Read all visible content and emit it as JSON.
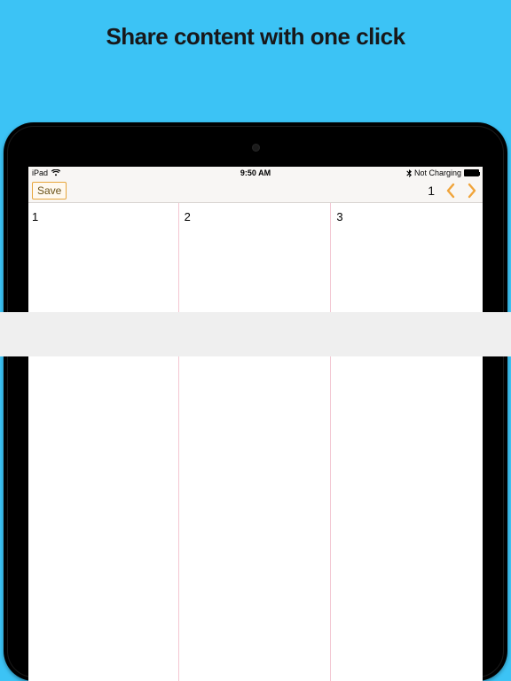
{
  "headline": "Share content with one click",
  "statusbar": {
    "carrier": "iPad",
    "wifi": "᯾",
    "time": "9:50 AM",
    "bt": "✱",
    "charge": "Not Charging"
  },
  "toolbar": {
    "save_label": "Save",
    "page_number": "1"
  },
  "columns": [
    {
      "label": "1"
    },
    {
      "label": "2"
    },
    {
      "label": "3"
    }
  ]
}
